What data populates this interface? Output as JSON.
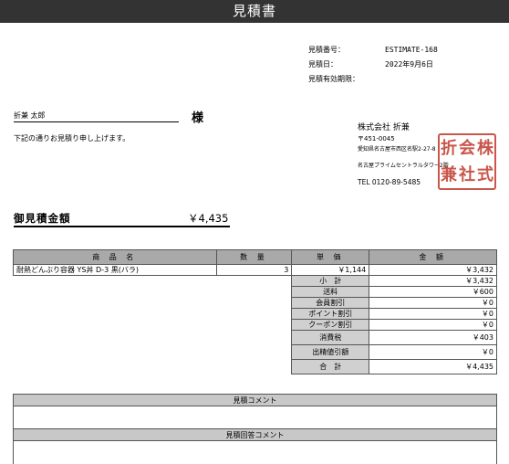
{
  "header": {
    "title": "見積書"
  },
  "meta": [
    {
      "label": "見積番号：",
      "value": "ESTIMATE-168"
    },
    {
      "label": "見積日：",
      "value": "2022年9月6日"
    },
    {
      "label": "見積有効期限：",
      "value": ""
    }
  ],
  "customer": {
    "name": "折兼 太郎",
    "honorific": "様",
    "intro": "下記の通りお見積り申し上げます。"
  },
  "company": {
    "name": "株式会社 折兼",
    "postal": "〒451-0045",
    "address": "愛知県名古屋市西区名駅2-27-8",
    "building": "名古屋プライムセントラルタワー2階",
    "tel": "TEL 0120-89-5485",
    "seal_chars": [
      "株",
      "式",
      "会",
      "社",
      "折",
      "兼"
    ],
    "seal_color": "#c0392b"
  },
  "total": {
    "label": "御見積金額",
    "value": "￥4,435"
  },
  "table": {
    "headers": [
      "商 品 名",
      "数 量",
      "単 価",
      "金 額"
    ],
    "rows": [
      {
        "name": "耐熱どんぶり容器 YS丼 D-3 黒(バラ)",
        "qty": "3",
        "unit_price": "￥1,144",
        "amount": "￥3,432"
      }
    ],
    "summary": [
      {
        "label": "小　計",
        "value": "￥3,432"
      },
      {
        "label": "送料",
        "value": "￥600"
      },
      {
        "label": "会員割引",
        "value": "￥0"
      },
      {
        "label": "ポイント割引",
        "value": "￥0"
      },
      {
        "label": "クーポン割引",
        "value": "￥0"
      },
      {
        "label": "消費税",
        "value": "￥403"
      },
      {
        "label": "出精値引額",
        "value": "￥0"
      },
      {
        "label": "合　計",
        "value": "￥4,435"
      }
    ]
  },
  "comments": {
    "estimate_comment": "見積コメント",
    "reply_comment": "見積回答コメント"
  }
}
